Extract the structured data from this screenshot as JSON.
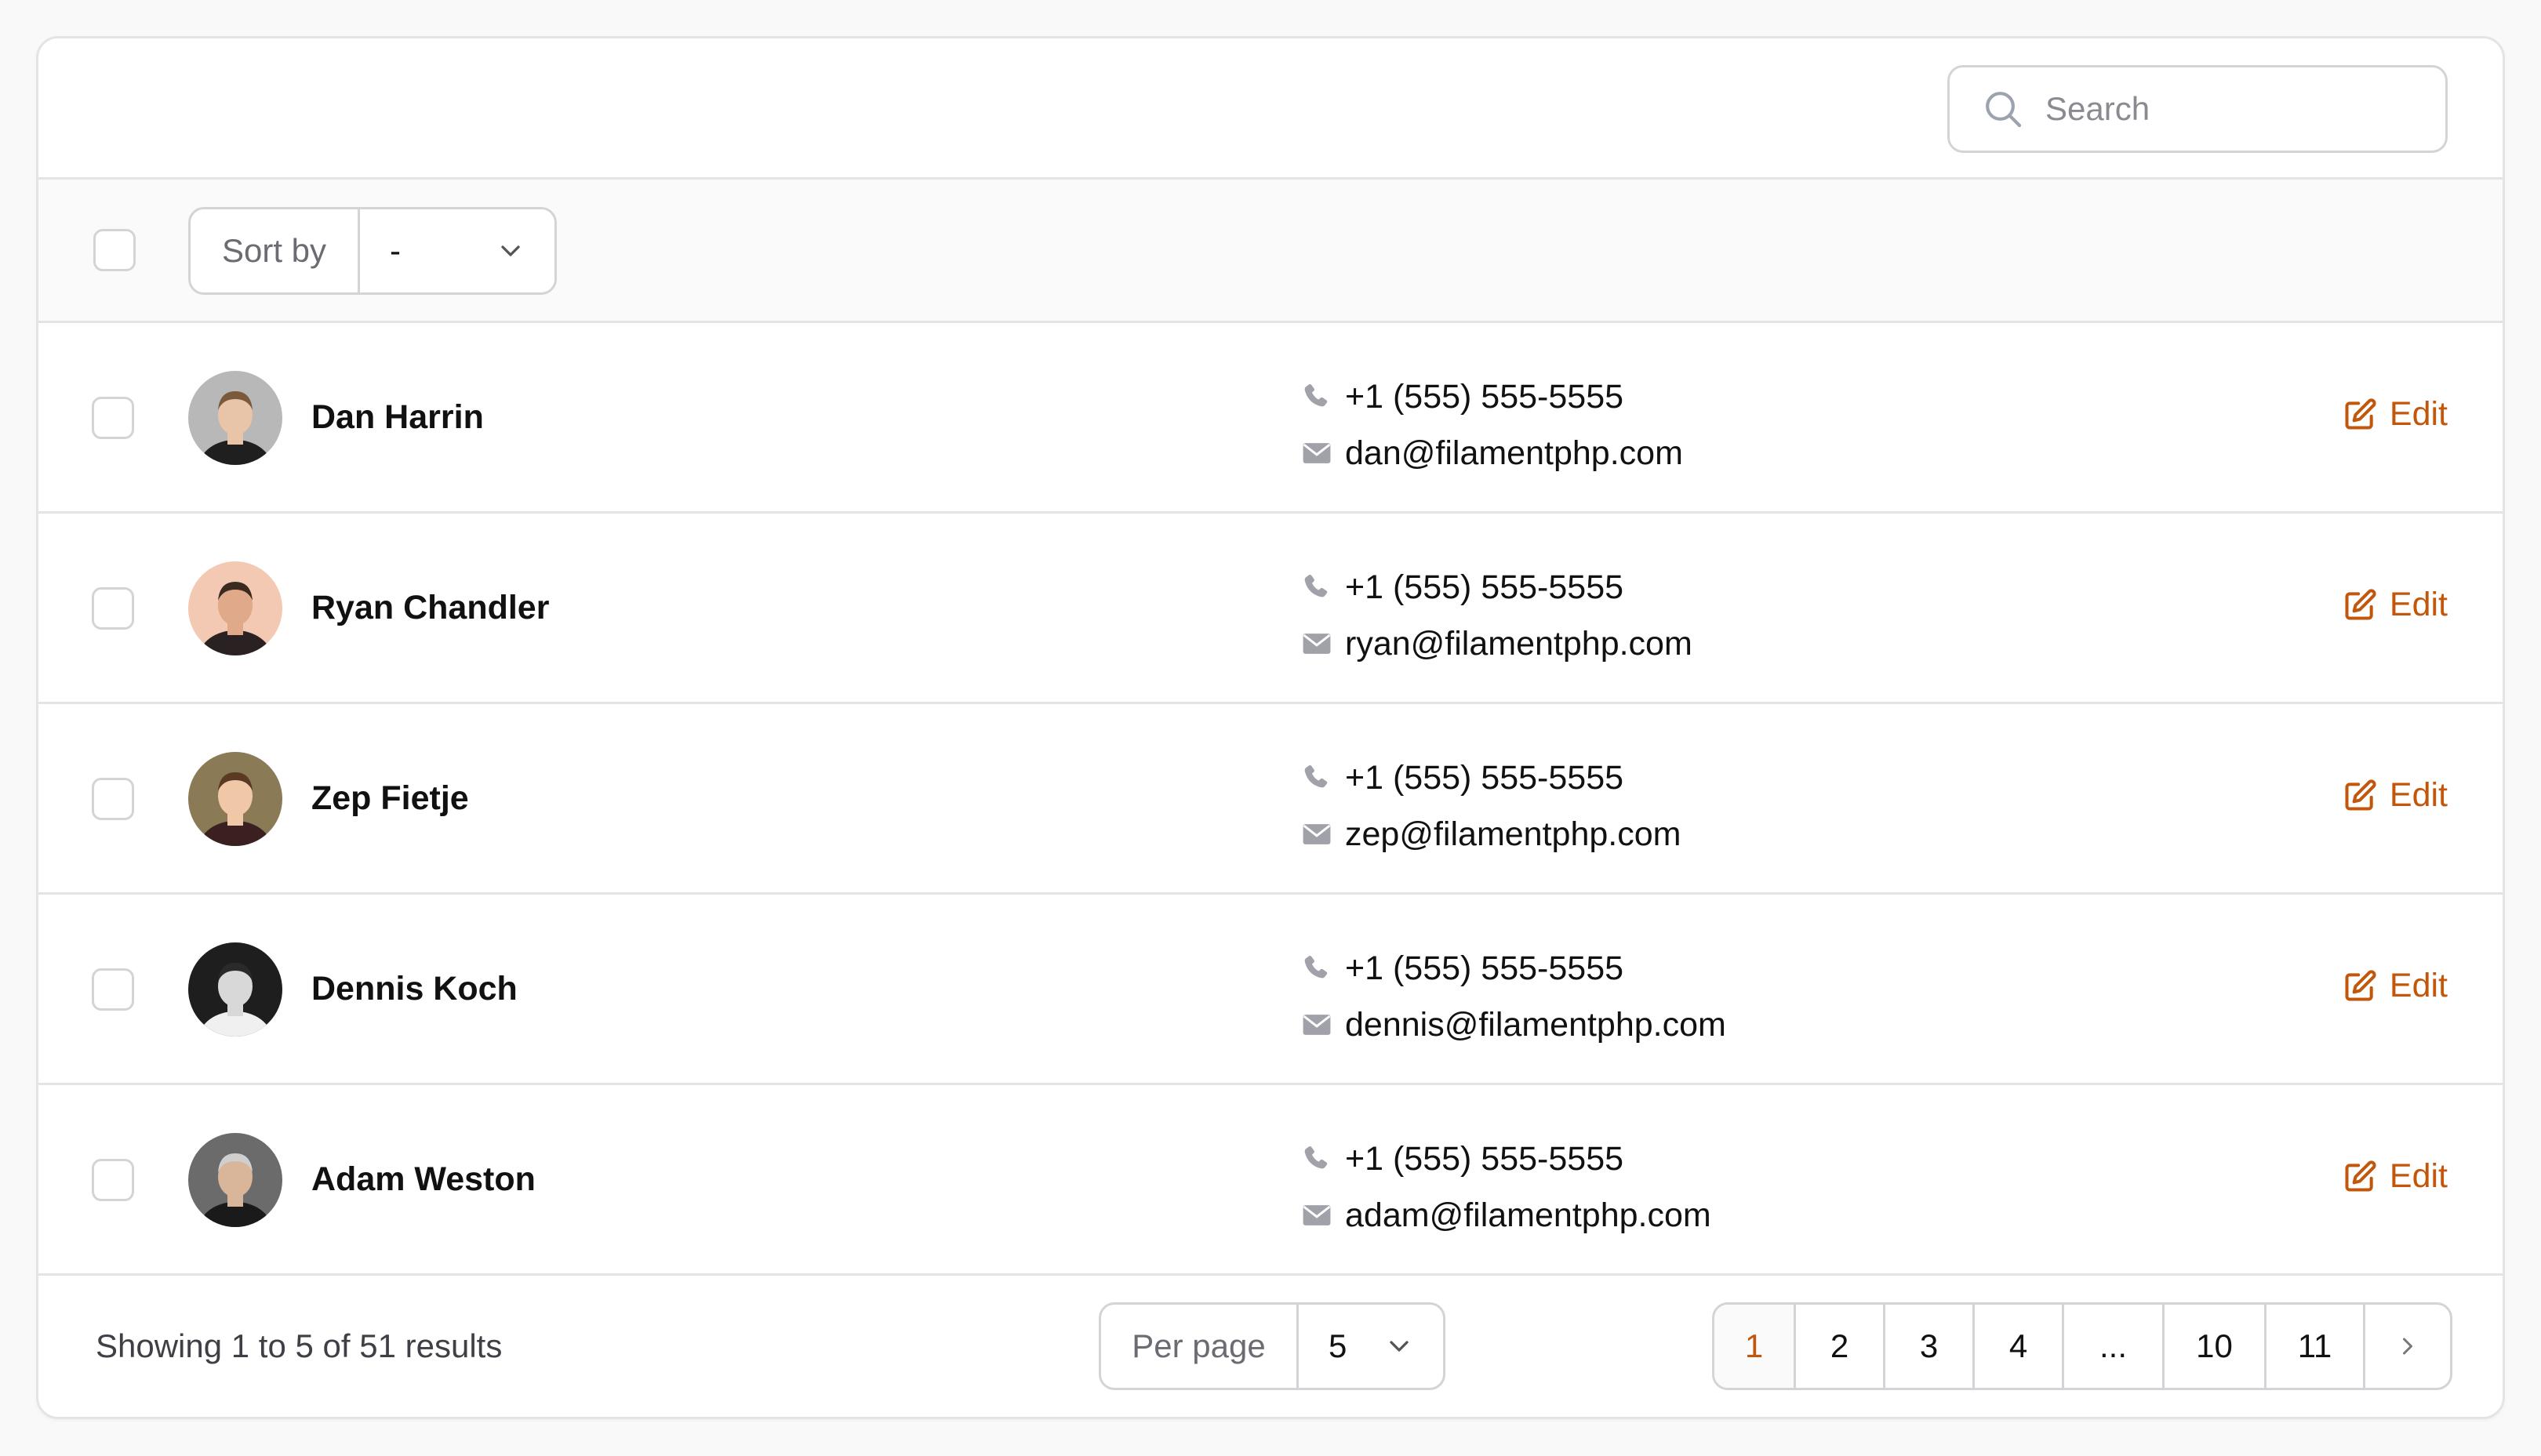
{
  "search": {
    "placeholder": "Search"
  },
  "toolbar": {
    "sort_label": "Sort by",
    "sort_value": "-"
  },
  "rows": [
    {
      "name": "Dan Harrin",
      "phone": "+1 (555) 555-5555",
      "email": "dan@filamentphp.com",
      "edit_label": "Edit"
    },
    {
      "name": "Ryan Chandler",
      "phone": "+1 (555) 555-5555",
      "email": "ryan@filamentphp.com",
      "edit_label": "Edit"
    },
    {
      "name": "Zep Fietje",
      "phone": "+1 (555) 555-5555",
      "email": "zep@filamentphp.com",
      "edit_label": "Edit"
    },
    {
      "name": "Dennis Koch",
      "phone": "+1 (555) 555-5555",
      "email": "dennis@filamentphp.com",
      "edit_label": "Edit"
    },
    {
      "name": "Adam Weston",
      "phone": "+1 (555) 555-5555",
      "email": "adam@filamentphp.com",
      "edit_label": "Edit"
    }
  ],
  "footer": {
    "summary": "Showing 1 to 5 of 51 results",
    "per_page_label": "Per page",
    "per_page_value": "5",
    "pages": [
      "1",
      "2",
      "3",
      "4",
      "...",
      "10",
      "11"
    ],
    "active_page": "1"
  },
  "colors": {
    "accent": "#c2570c",
    "border": "#e4e4e7",
    "muted_icon": "#9ca3af"
  },
  "icons": {
    "search": "magnifier-icon",
    "phone": "phone-icon",
    "email": "envelope-icon",
    "edit": "pencil-square-icon",
    "chevron": "chevron-down-icon",
    "next": "chevron-right-icon"
  }
}
